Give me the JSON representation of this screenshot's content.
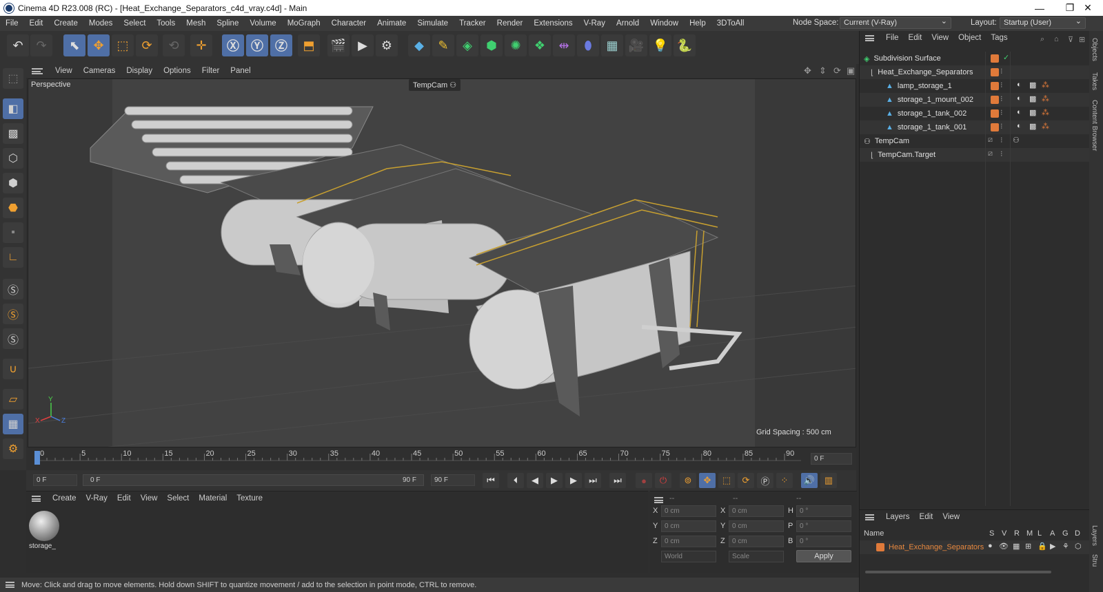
{
  "window": {
    "title": "Cinema 4D R23.008 (RC) - [Heat_Exchange_Separators_c4d_vray.c4d] - Main",
    "minimize": "—",
    "restore": "❐",
    "close": "✕"
  },
  "menubar": {
    "items": [
      "File",
      "Edit",
      "Create",
      "Modes",
      "Select",
      "Tools",
      "Mesh",
      "Spline",
      "Volume",
      "MoGraph",
      "Character",
      "Animate",
      "Simulate",
      "Tracker",
      "Render",
      "Extensions",
      "V-Ray",
      "Arnold",
      "Window",
      "Help",
      "3DToAll"
    ],
    "node_space_label": "Node Space:",
    "node_space_value": "Current (V-Ray)",
    "layout_label": "Layout:",
    "layout_value": "Startup (User)"
  },
  "viewport_menu": [
    "View",
    "Cameras",
    "Display",
    "Options",
    "Filter",
    "Panel"
  ],
  "viewport": {
    "name": "Perspective",
    "camera": "TempCam",
    "grid_spacing": "Grid Spacing : 500 cm",
    "axis_x": "X",
    "axis_y": "Y",
    "axis_z": "Z"
  },
  "timeline": {
    "ticks": [
      "0",
      "5",
      "10",
      "15",
      "20",
      "25",
      "30",
      "35",
      "40",
      "45",
      "50",
      "55",
      "60",
      "65",
      "70",
      "75",
      "80",
      "85",
      "90"
    ],
    "current_frame": "0 F",
    "start_frame": "0 F",
    "range_start": "0 F",
    "range_end": "90 F",
    "end_frame": "90 F"
  },
  "material_panel": {
    "menu": [
      "Create",
      "V-Ray",
      "Edit",
      "View",
      "Select",
      "Material",
      "Texture"
    ],
    "material_name": "storage_"
  },
  "coord_panel": {
    "headers": [
      "--",
      "--",
      "--"
    ],
    "rows": [
      {
        "a": "X",
        "av": "0 cm",
        "b": "X",
        "bv": "0 cm",
        "c": "H",
        "cv": "0 °"
      },
      {
        "a": "Y",
        "av": "0 cm",
        "b": "Y",
        "bv": "0 cm",
        "c": "P",
        "cv": "0 °"
      },
      {
        "a": "Z",
        "av": "0 cm",
        "b": "Z",
        "bv": "0 cm",
        "c": "B",
        "cv": "0 °"
      }
    ],
    "world": "World",
    "scale": "Scale",
    "apply": "Apply"
  },
  "status": "Move: Click and drag to move elements. Hold down SHIFT to quantize movement / add to the selection in point mode, CTRL to remove.",
  "object_manager": {
    "menu": [
      "File",
      "Edit",
      "View",
      "Object",
      "Tags"
    ],
    "objects": [
      {
        "name": "Subdivision Surface"
      },
      {
        "name": "Heat_Exchange_Separators"
      },
      {
        "name": "lamp_storage_1"
      },
      {
        "name": "storage_1_mount_002"
      },
      {
        "name": "storage_1_tank_002"
      },
      {
        "name": "storage_1_tank_001"
      },
      {
        "name": "TempCam"
      },
      {
        "name": "TempCam.Target"
      }
    ]
  },
  "layers": {
    "menu": [
      "Layers",
      "Edit",
      "View"
    ],
    "col_name": "Name",
    "flags": [
      "S",
      "V",
      "R",
      "M",
      "L",
      "A",
      "G",
      "D"
    ],
    "layer_name": "Heat_Exchange_Separators"
  },
  "side_tabs": [
    "Objects",
    "Takes",
    "Content Browser",
    "Layers",
    "Stru"
  ],
  "colors": {
    "accent": "#4f6fa6",
    "layer": "#e07a3a",
    "selected_text": "#e8893f"
  }
}
